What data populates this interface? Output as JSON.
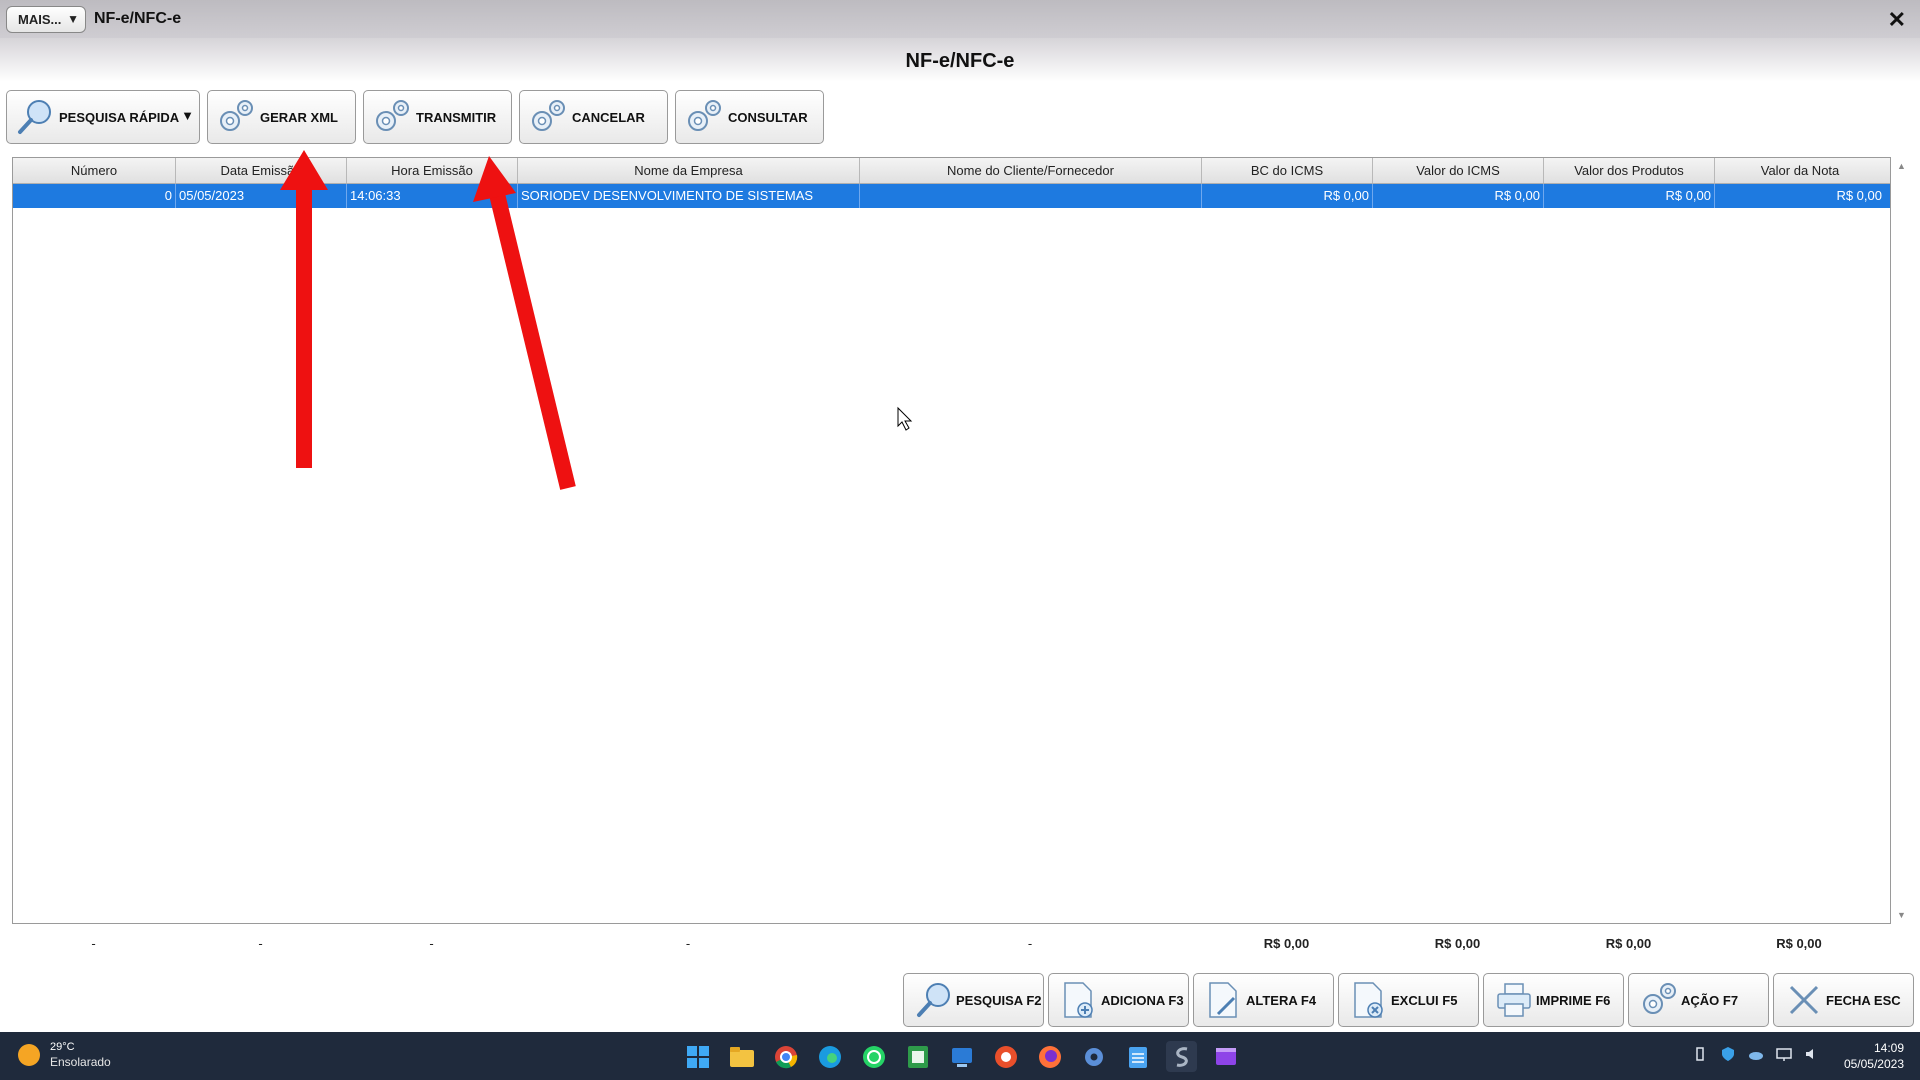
{
  "window": {
    "mais_label": "MAIS...",
    "title": "NF-e/NFC-e",
    "page_title": "NF-e/NFC-e"
  },
  "toolbar": {
    "pesquisa_rapida": "PESQUISA RÁPIDA",
    "gerar_xml": "GERAR XML",
    "transmitir": "TRANSMITIR",
    "cancelar": "CANCELAR",
    "consultar": "CONSULTAR"
  },
  "grid": {
    "columns": [
      "Número",
      "Data Emissão",
      "Hora Emissão",
      "Nome da Empresa",
      "Nome do Cliente/Fornecedor",
      "BC do ICMS",
      "Valor do ICMS",
      "Valor dos Produtos",
      "Valor da Nota"
    ],
    "rows": [
      [
        "0",
        "05/05/2023",
        "14:06:33",
        "SORIODEV DESENVOLVIMENTO DE SISTEMAS",
        "",
        "R$ 0,00",
        "R$ 0,00",
        "R$ 0,00",
        "R$ 0,00"
      ]
    ]
  },
  "totals": [
    "-",
    "-",
    "-",
    "-",
    "-",
    "R$ 0,00",
    "R$ 0,00",
    "R$ 0,00",
    "R$ 0,00"
  ],
  "bottom_buttons": {
    "pesquisa": "PESQUISA F2",
    "adiciona": "ADICIONA F3",
    "altera": "ALTERA F4",
    "exclui": "EXCLUI F5",
    "imprime": "IMPRIME F6",
    "acao": "AÇÃO F7",
    "fecha": "FECHA ESC"
  },
  "taskbar": {
    "temp": "29°C",
    "weather": "Ensolarado",
    "time": "14:09",
    "date": "05/05/2023",
    "apps": [
      "windows-start-icon",
      "file-explorer-icon",
      "chrome-icon",
      "edge-icon",
      "whatsapp-icon",
      "spreadsheet-icon",
      "remote-desktop-icon",
      "app-icon",
      "firefox-icon",
      "settings-icon",
      "notepad-icon",
      "soriodev-icon",
      "video-editor-icon"
    ]
  },
  "colors": {
    "selection": "#1e7ae0",
    "arrow": "#ee1111",
    "taskbar": "#1f2a3c"
  }
}
